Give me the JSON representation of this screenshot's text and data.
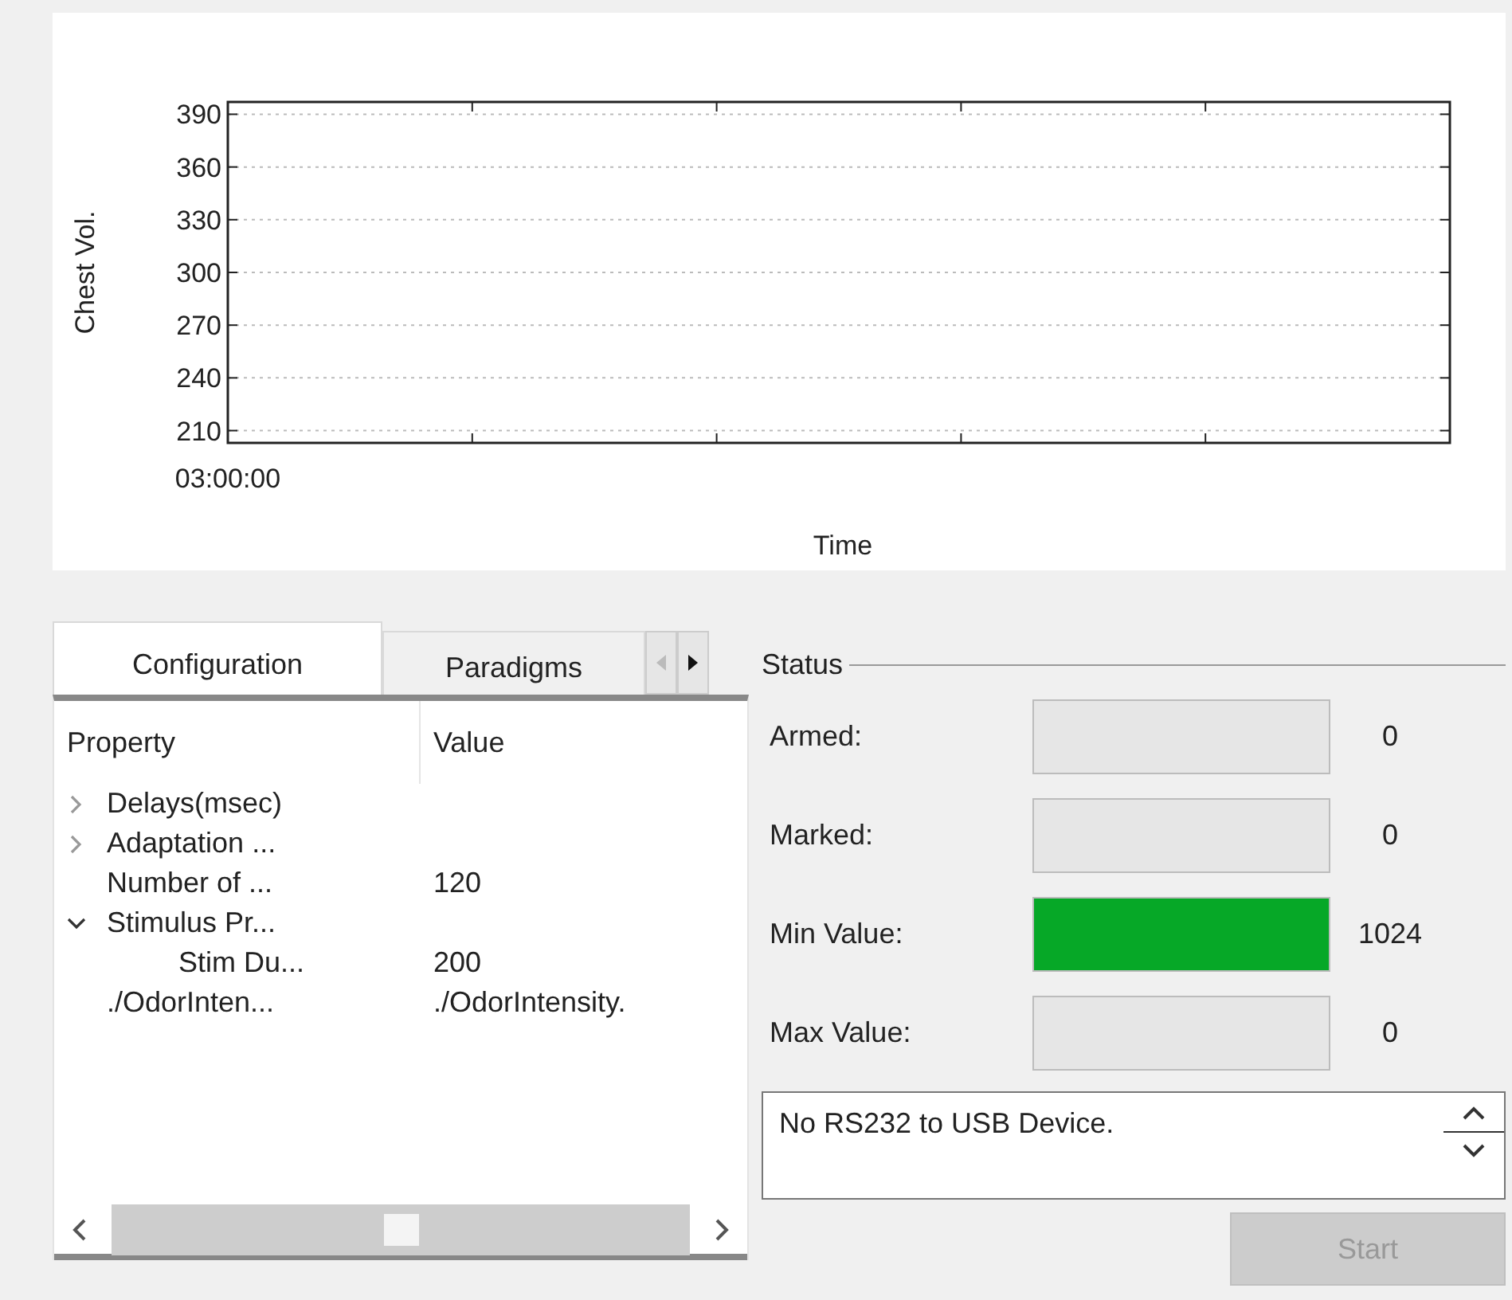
{
  "chart": {
    "chart_data": {
      "type": "line",
      "grid": true,
      "categories": [
        "03:00:00",
        null,
        null,
        null,
        null,
        null
      ],
      "series": [
        {
          "values": [
            null,
            null,
            null,
            null,
            null,
            null
          ]
        }
      ],
      "xlabel": "Time",
      "ylabel": "Chest Vol.",
      "ylim": [
        203,
        397
      ],
      "yticks": [
        {
          "value": 210,
          "label": "210"
        },
        {
          "value": 240,
          "label": "240"
        },
        {
          "value": 270,
          "label": "270"
        },
        {
          "value": 300,
          "label": "300"
        },
        {
          "value": 330,
          "label": "330"
        },
        {
          "value": 360,
          "label": "360"
        },
        {
          "value": 390,
          "label": "390"
        }
      ]
    }
  },
  "tabs": [
    {
      "label": "Configuration",
      "selected": true
    },
    {
      "label": "Paradigms",
      "selected": false
    }
  ],
  "property_tree": {
    "columns": [
      "Property",
      "Value"
    ],
    "items": [
      {
        "property": "Delays(msec)",
        "expanded": false
      },
      {
        "property": "Adaptation ...",
        "expanded": false
      },
      {
        "property": "Number of ...",
        "value": "120"
      },
      {
        "property": "Stimulus Pr...",
        "expanded": true,
        "children": [
          {
            "property": "Stim Du...",
            "value": "200"
          }
        ]
      },
      {
        "property": "./OdorInten...",
        "value": "./OdorIntensity."
      }
    ]
  },
  "status": {
    "title": "Status",
    "rows": [
      {
        "label": "Armed:",
        "level": 0,
        "reading": "0"
      },
      {
        "label": "Marked:",
        "level": 0,
        "reading": "0"
      },
      {
        "label": "Min Value:",
        "level": 1,
        "reading": "1024"
      },
      {
        "label": "Max Value:",
        "level": 0,
        "reading": "0"
      }
    ],
    "message": "No RS232 to USB Device.",
    "start_button": {
      "label": "Start",
      "disabled": true
    }
  }
}
